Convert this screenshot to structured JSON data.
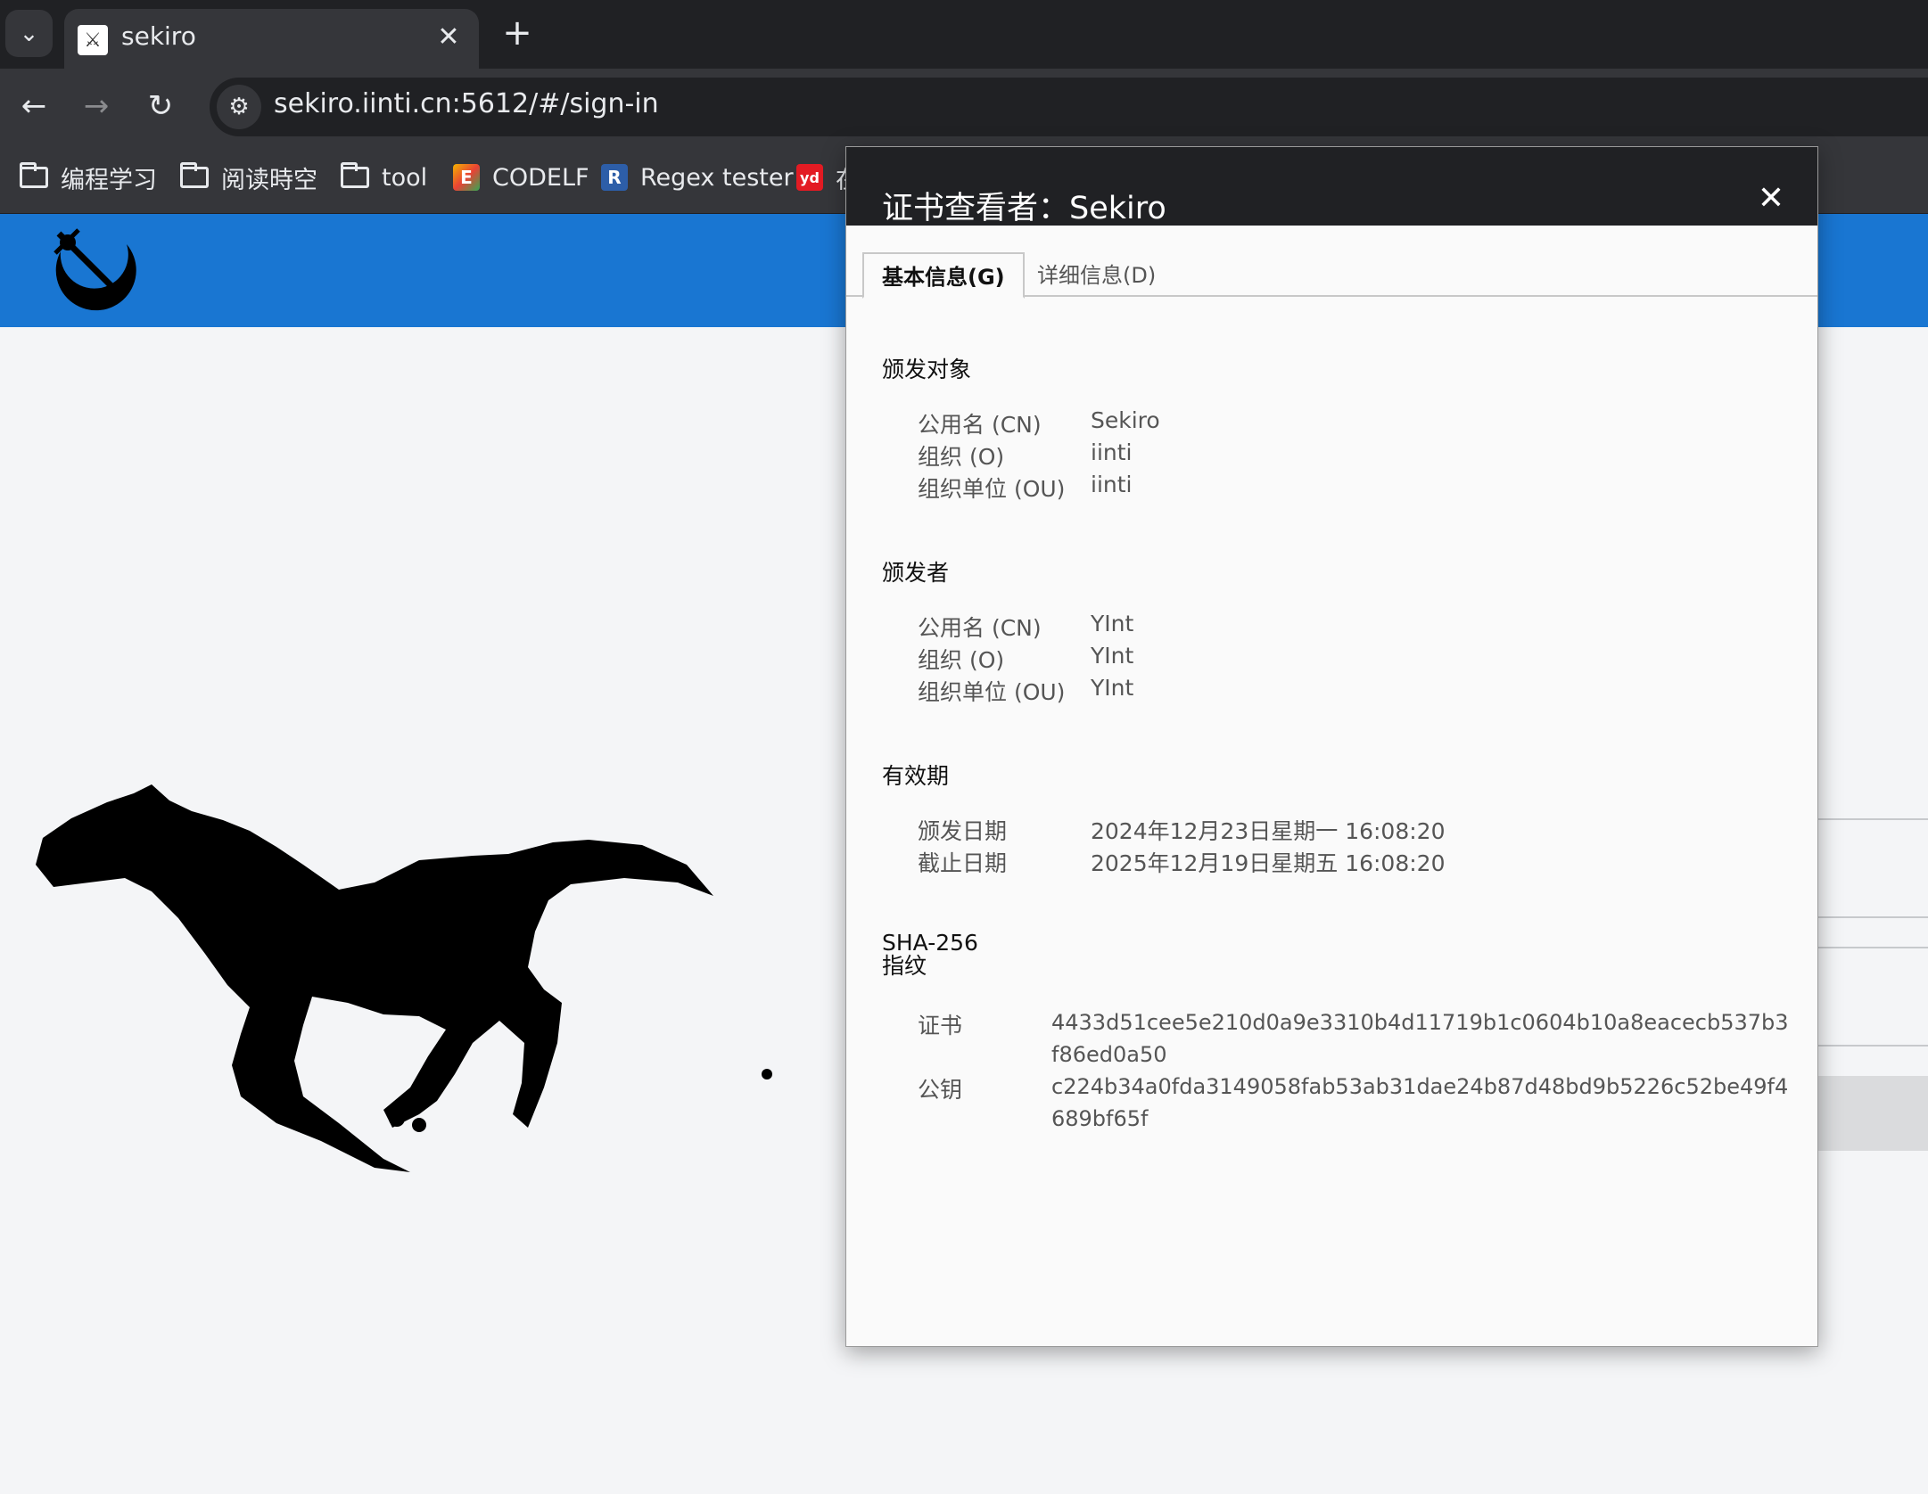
{
  "browser": {
    "tab": {
      "title": "sekiro",
      "close": "✕"
    },
    "new_tab": "+",
    "url": "sekiro.iinti.cn:5612/#/sign-in",
    "bookmarks": [
      {
        "label": "编程学习",
        "icon": "folder-icon"
      },
      {
        "label": "阅读時空",
        "icon": "folder-icon"
      },
      {
        "label": "tool",
        "icon": "folder-icon"
      },
      {
        "label": "CODELF",
        "icon": "codelf-icon"
      },
      {
        "label": "Regex tester",
        "icon": "regex-icon",
        "badge": "R"
      },
      {
        "label": "在",
        "icon": "youdao-icon",
        "badge": "yd"
      }
    ]
  },
  "dialog": {
    "title": "证书查看者：Sekiro",
    "tabs": [
      "基本信息(G)",
      "详细信息(D)"
    ],
    "issued_to": {
      "title": "颁发对象",
      "rows": [
        {
          "label": "公用名 (CN)",
          "value": "Sekiro"
        },
        {
          "label": "组织 (O)",
          "value": "iinti"
        },
        {
          "label": "组织单位 (OU)",
          "value": "iinti"
        }
      ]
    },
    "issued_by": {
      "title": "颁发者",
      "rows": [
        {
          "label": "公用名 (CN)",
          "value": "YInt"
        },
        {
          "label": "组织 (O)",
          "value": "YInt"
        },
        {
          "label": "组织单位 (OU)",
          "value": "YInt"
        }
      ]
    },
    "validity": {
      "title": "有效期",
      "rows": [
        {
          "label": "颁发日期",
          "value": "2024年12月23日星期一 16:08:20"
        },
        {
          "label": "截止日期",
          "value": "2025年12月19日星期五 16:08:20"
        }
      ]
    },
    "fingerprint": {
      "title": "SHA-256 指纹",
      "rows": [
        {
          "label": "证书",
          "value": "4433d51cee5e210d0a9e3310b4d11719b1c0604b10a8eacecb537b3f86ed0a50"
        },
        {
          "label": "公钥",
          "value": "c224b34a0fda3149058fab53ab31dae24b87d48bd9b5226c52be49f4689bf65f"
        }
      ]
    }
  },
  "colors": {
    "header_blue": "#1976d2",
    "chrome_dark": "#202124",
    "chrome_mid": "#35363a"
  }
}
